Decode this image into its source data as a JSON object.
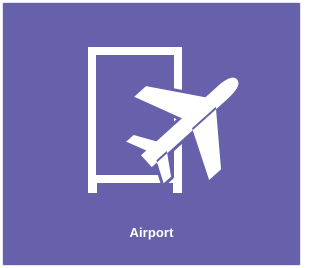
{
  "tile": {
    "label": "Airport",
    "icon": "airport-icon",
    "background_color": "#6661AA",
    "icon_color": "#FFFFFF",
    "label_color": "#FFFFFF"
  }
}
